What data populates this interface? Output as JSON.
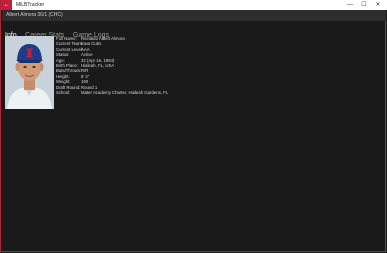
{
  "titlebar": {
    "back_glyph": "←",
    "title": "MiLBTracker",
    "minimize_glyph": "—",
    "maximize_glyph": "☐",
    "close_glyph": "✕"
  },
  "header": {
    "text": "Albert Almora  36/1 (CHC)"
  },
  "tabs": [
    {
      "label": "Info"
    },
    {
      "label": "Career Stats"
    },
    {
      "label": "Game Logs"
    }
  ],
  "player": {
    "fields": [
      {
        "label": "Full Name:",
        "value": "Reinaldo Albert Almora"
      },
      {
        "label": "Current Team:",
        "value": "Iowa Cubs"
      },
      {
        "label": "Current Level:",
        "value": "AAA"
      },
      {
        "label": "Status:",
        "value": "Active"
      },
      {
        "label": "Age:",
        "value": "22 (Apr 16, 1994)"
      },
      {
        "label": "Birth Place:",
        "value": "Hialeah, FL, USA"
      },
      {
        "label": "Bats/Throws:",
        "value": "R/R"
      },
      {
        "label": "Height:",
        "value": "6' 2\""
      },
      {
        "label": "Weight:",
        "value": "190"
      },
      {
        "label": "Draft Round:",
        "value": "Round 1"
      },
      {
        "label": "School:",
        "value": "Mater Academy Charter, Hialeah Gardens, FL"
      }
    ]
  },
  "colors": {
    "accent": "#c41e3a",
    "background": "#1a1a1a",
    "header": "#2d2d2d",
    "cap": "#1e3b8a"
  }
}
